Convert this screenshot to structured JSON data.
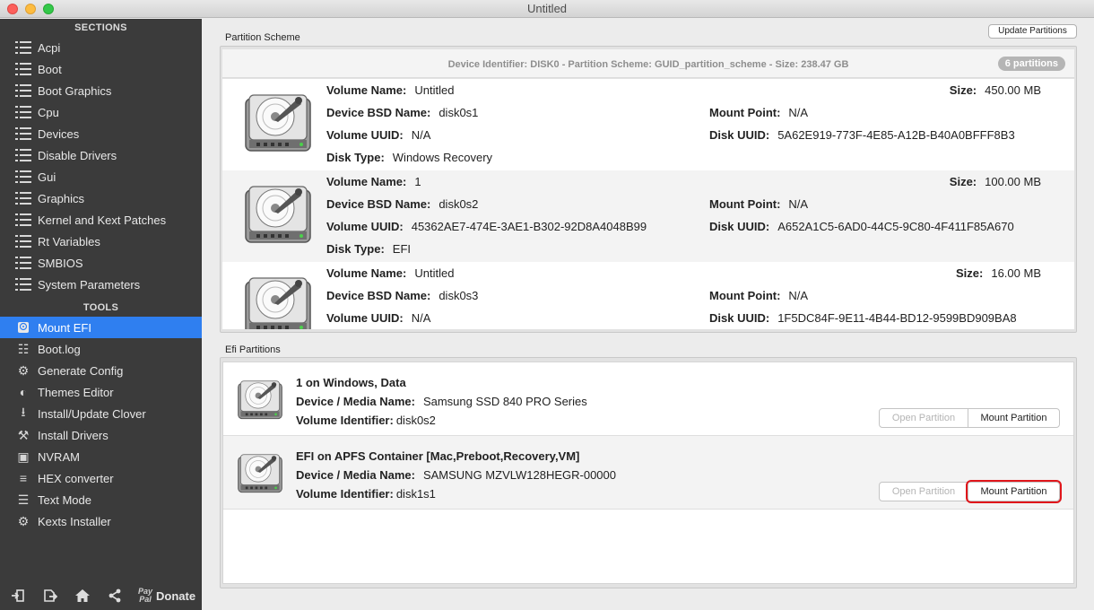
{
  "window": {
    "title": "Untitled"
  },
  "sidebar": {
    "sections_header": "SECTIONS",
    "sections": [
      {
        "label": "Acpi"
      },
      {
        "label": "Boot"
      },
      {
        "label": "Boot Graphics"
      },
      {
        "label": "Cpu"
      },
      {
        "label": "Devices"
      },
      {
        "label": "Disable Drivers"
      },
      {
        "label": "Gui"
      },
      {
        "label": "Graphics"
      },
      {
        "label": "Kernel and Kext Patches"
      },
      {
        "label": "Rt Variables"
      },
      {
        "label": "SMBIOS"
      },
      {
        "label": "System Parameters"
      }
    ],
    "tools_header": "TOOLS",
    "tools": [
      {
        "label": "Mount EFI",
        "icon": "disk-icon",
        "active": true
      },
      {
        "label": "Boot.log",
        "icon": "log-icon"
      },
      {
        "label": "Generate Config",
        "icon": "gears-icon"
      },
      {
        "label": "Themes Editor",
        "icon": "palette-icon"
      },
      {
        "label": "Install/Update Clover",
        "icon": "download-icon"
      },
      {
        "label": "Install Drivers",
        "icon": "tools-icon"
      },
      {
        "label": "NVRAM",
        "icon": "chip-icon"
      },
      {
        "label": "HEX converter",
        "icon": "hex-icon"
      },
      {
        "label": "Text Mode",
        "icon": "text-icon"
      },
      {
        "label": "Kexts Installer",
        "icon": "kext-icon"
      }
    ],
    "footer": {
      "paypal_line1": "Pay",
      "paypal_line2": "Pal",
      "donate": "Donate"
    }
  },
  "main": {
    "update_button": "Update Partitions",
    "partition_scheme_label": "Partition Scheme",
    "device_summary": "Device Identifier: DISK0 - Partition Scheme: GUID_partition_scheme - Size: 238.47 GB",
    "partition_count": "6 partitions",
    "labels": {
      "volume_name": "Volume Name:",
      "device_bsd": "Device BSD Name:",
      "volume_uuid": "Volume UUID:",
      "disk_type": "Disk Type:",
      "size": "Size:",
      "mount_point": "Mount Point:",
      "disk_uuid": "Disk UUID:"
    },
    "partitions": [
      {
        "volume_name": "Untitled",
        "bsd": "disk0s1",
        "volume_uuid": "N/A",
        "disk_type": "Windows Recovery",
        "size": "450.00 MB",
        "mount_point": "N/A",
        "disk_uuid": "5A62E919-773F-4E85-A12B-B40A0BFFF8B3"
      },
      {
        "volume_name": "1",
        "bsd": "disk0s2",
        "volume_uuid": "45362AE7-474E-3AE1-B302-92D8A4048B99",
        "disk_type": "EFI",
        "size": "100.00 MB",
        "mount_point": "N/A",
        "disk_uuid": "A652A1C5-6AD0-44C5-9C80-4F411F85A670"
      },
      {
        "volume_name": "Untitled",
        "bsd": "disk0s3",
        "volume_uuid": "N/A",
        "disk_type": "",
        "size": "16.00 MB",
        "mount_point": "N/A",
        "disk_uuid": "1F5DC84F-9E11-4B44-BD12-9599BD909BA8"
      }
    ],
    "efi_label": "Efi Partitions",
    "efi_labels": {
      "device_media": "Device / Media Name:",
      "volume_identifier": "Volume Identifier:"
    },
    "efi_partitions": [
      {
        "title": "1 on Windows, Data",
        "device_media": "Samsung SSD 840 PRO Series",
        "volume_identifier": "disk0s2",
        "open_label": "Open Partition",
        "mount_label": "Mount Partition"
      },
      {
        "title": "EFI on APFS Container [Mac,Preboot,Recovery,VM]",
        "device_media": "SAMSUNG MZVLW128HEGR-00000",
        "volume_identifier": "disk1s1",
        "open_label": "Open Partition",
        "mount_label": "Mount Partition"
      }
    ],
    "colors": {
      "accent": "#2f7ff0",
      "highlight": "#e0161b"
    }
  }
}
